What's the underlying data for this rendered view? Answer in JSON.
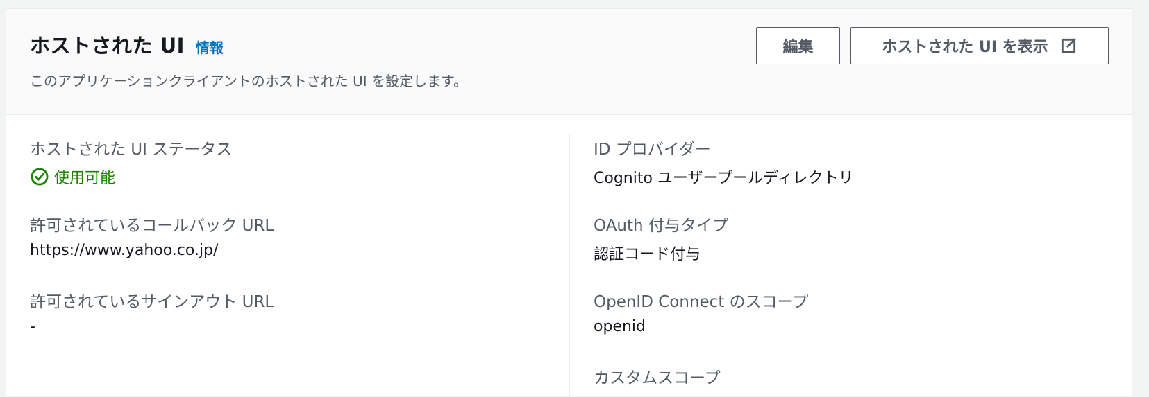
{
  "header": {
    "title": "ホストされた UI",
    "info_link": "情報",
    "description": "このアプリケーションクライアントのホストされた UI を設定します。",
    "edit_button": "編集",
    "view_button": "ホストされた UI を表示"
  },
  "left_fields": [
    {
      "label": "ホストされた UI ステータス",
      "value": "使用可能"
    },
    {
      "label": "許可されているコールバック URL",
      "value": "https://www.yahoo.co.jp/"
    },
    {
      "label": "許可されているサインアウト URL",
      "value": "-"
    }
  ],
  "right_fields": [
    {
      "label": "ID プロバイダー",
      "value": "Cognito ユーザープールディレクトリ"
    },
    {
      "label": "OAuth 付与タイプ",
      "value": "認証コード付与"
    },
    {
      "label": "OpenID Connect のスコープ",
      "value": "openid"
    },
    {
      "label": "カスタムスコープ",
      "value": ""
    }
  ],
  "colors": {
    "status_ok": "#1d8102",
    "link": "#0073bb",
    "label": "#545b64",
    "text": "#16191f"
  },
  "icons": {
    "status": "check-circle-icon",
    "external": "external-link-icon"
  }
}
